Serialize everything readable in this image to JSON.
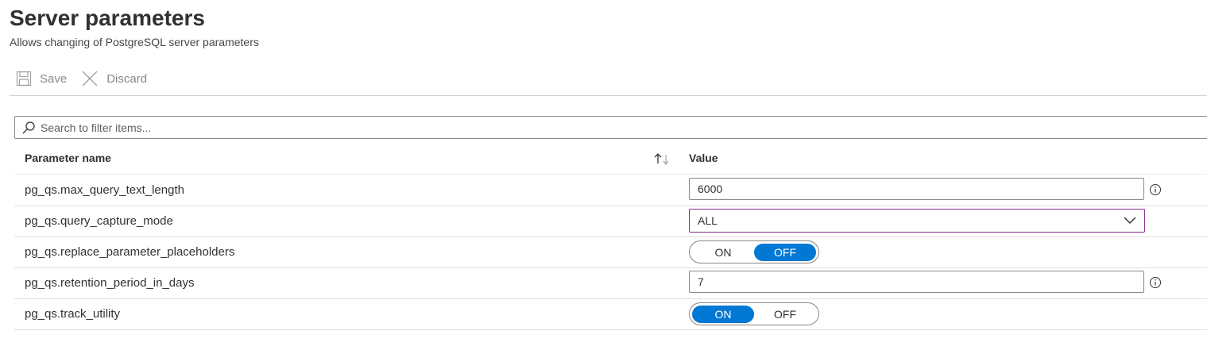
{
  "header": {
    "title": "Server parameters",
    "subtitle": "Allows changing of PostgreSQL server parameters"
  },
  "toolbar": {
    "save_label": "Save",
    "discard_label": "Discard"
  },
  "search": {
    "placeholder": "Search to filter items..."
  },
  "table": {
    "columns": {
      "name": "Parameter name",
      "value": "Value"
    },
    "rows": [
      {
        "name": "pg_qs.max_query_text_length",
        "type": "text",
        "value": "6000"
      },
      {
        "name": "pg_qs.query_capture_mode",
        "type": "select",
        "value": "ALL"
      },
      {
        "name": "pg_qs.replace_parameter_placeholders",
        "type": "toggle",
        "on_label": "ON",
        "off_label": "OFF",
        "selected": "OFF"
      },
      {
        "name": "pg_qs.retention_period_in_days",
        "type": "text",
        "value": "7"
      },
      {
        "name": "pg_qs.track_utility",
        "type": "toggle",
        "on_label": "ON",
        "off_label": "OFF",
        "selected": "ON"
      }
    ]
  },
  "colors": {
    "accent": "#0078d4",
    "select_border": "#8a2d8f"
  }
}
